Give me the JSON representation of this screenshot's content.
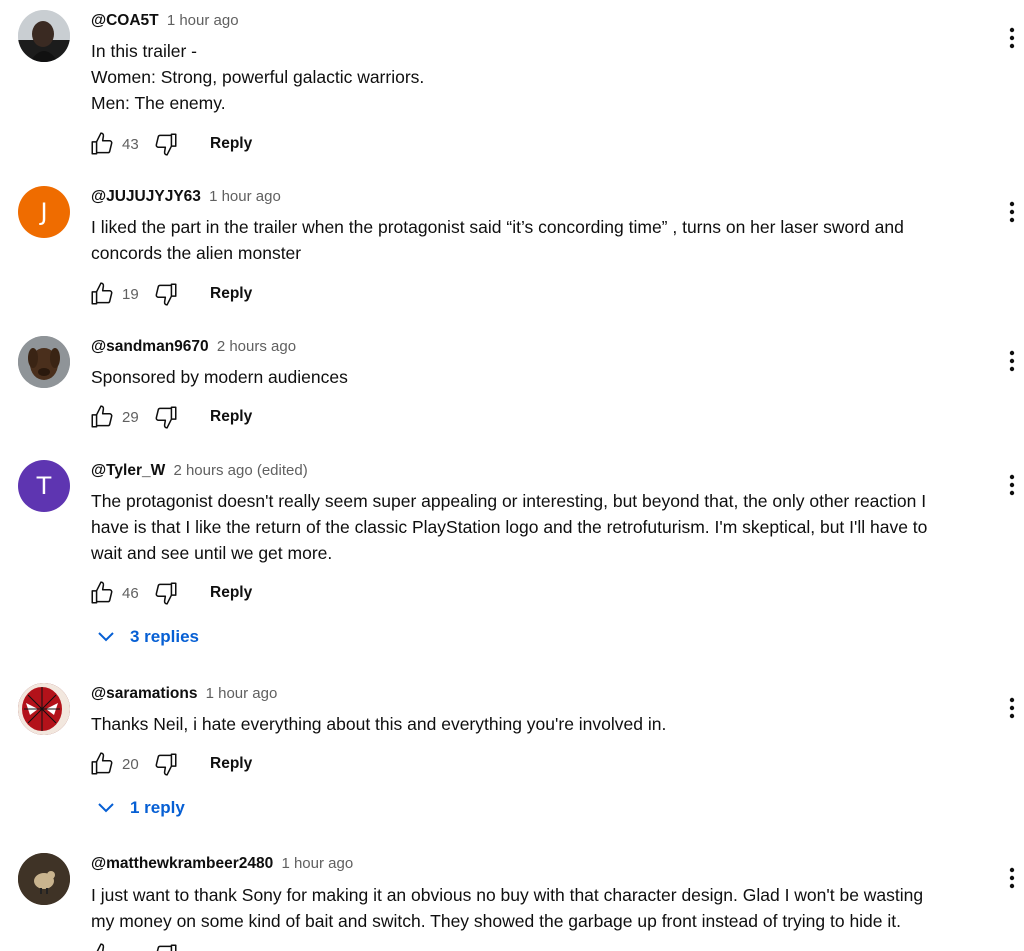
{
  "comments": [
    {
      "author": "@COA5T",
      "time": "1 hour ago",
      "lines": [
        "In this trailer -",
        "Women: Strong, powerful galactic warriors.",
        "Men: The enemy."
      ],
      "likes": "43",
      "reply_label": "Reply",
      "avatar_icon": "person-photo-icon"
    },
    {
      "author": "@JUJUJYJY63",
      "time": "1 hour ago",
      "lines": [
        "I liked the part in the trailer when the protagonist said “it’s concording time” , turns on her laser sword and",
        "concords the alien monster"
      ],
      "likes": "19",
      "reply_label": "Reply",
      "avatar_letter": "J",
      "avatar_color": "#ef6c00"
    },
    {
      "author": "@sandman9670",
      "time": "2 hours ago",
      "lines": [
        "Sponsored by modern audiences"
      ],
      "likes": "29",
      "reply_label": "Reply",
      "avatar_icon": "dog-photo-icon"
    },
    {
      "author": "@Tyler_W",
      "time": "2 hours ago (edited)",
      "lines": [
        "The protagonist doesn't really seem super appealing or interesting, but beyond that, the only other reaction I",
        "have is that I like the return of the classic PlayStation logo and the retrofuturism. I'm skeptical, but I'll have to",
        "wait and see until we get more."
      ],
      "likes": "46",
      "reply_label": "Reply",
      "replies_label": "3 replies",
      "avatar_letter": "T",
      "avatar_color": "#5e35b1"
    },
    {
      "author": "@saramations",
      "time": "1 hour ago",
      "lines": [
        "Thanks Neil, i hate everything about this and everything you're involved in."
      ],
      "likes": "20",
      "reply_label": "Reply",
      "replies_label": "1 reply",
      "avatar_icon": "spiderman-photo-icon"
    },
    {
      "author": "@matthewkrambeer2480",
      "time": "1 hour ago",
      "lines": [
        "I just want to thank Sony for making it an obvious no buy with that character design.  Glad I won't be wasting",
        "my money on some kind of bait and switch.  They showed the garbage up front instead of trying to hide it."
      ],
      "avatar_icon": "bird-photo-icon"
    }
  ],
  "colors": {
    "link": "#065fd4",
    "secondary": "#606060",
    "text": "#0f0f0f"
  }
}
